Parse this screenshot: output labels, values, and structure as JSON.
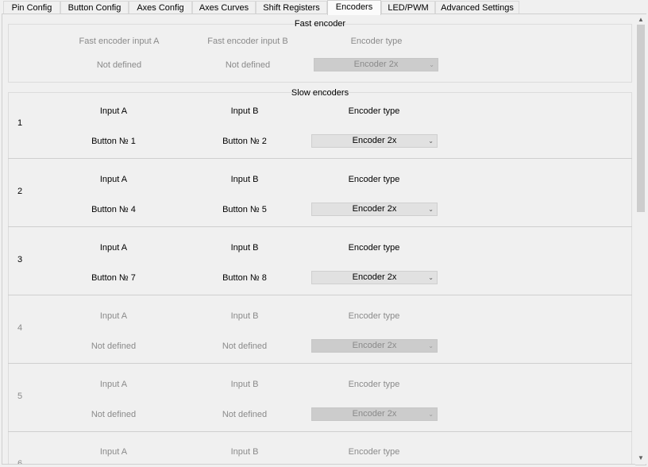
{
  "tabs": [
    {
      "label": "Pin Config",
      "active": false
    },
    {
      "label": "Button Config",
      "active": false
    },
    {
      "label": "Axes Config",
      "active": false
    },
    {
      "label": "Axes Curves",
      "active": false
    },
    {
      "label": "Shift Registers",
      "active": false
    },
    {
      "label": "Encoders",
      "active": true
    },
    {
      "label": "LED/PWM",
      "active": false
    },
    {
      "label": "Advanced Settings",
      "active": false
    }
  ],
  "fast": {
    "title": "Fast encoder",
    "header_a": "Fast encoder input A",
    "header_b": "Fast encoder input B",
    "header_type": "Encoder type",
    "value_a": "Not defined",
    "value_b": "Not defined",
    "type_value": "Encoder 2x"
  },
  "slow": {
    "title": "Slow encoders",
    "rows": [
      {
        "num": "1",
        "label_a": "Input A",
        "label_b": "Input B",
        "label_type": "Encoder type",
        "value_a": "Button № 1",
        "value_b": "Button № 2",
        "type_value": "Encoder 2x",
        "enabled": true
      },
      {
        "num": "2",
        "label_a": "Input A",
        "label_b": "Input B",
        "label_type": "Encoder type",
        "value_a": "Button № 4",
        "value_b": "Button № 5",
        "type_value": "Encoder 2x",
        "enabled": true
      },
      {
        "num": "3",
        "label_a": "Input A",
        "label_b": "Input B",
        "label_type": "Encoder type",
        "value_a": "Button № 7",
        "value_b": "Button № 8",
        "type_value": "Encoder 2x",
        "enabled": true
      },
      {
        "num": "4",
        "label_a": "Input A",
        "label_b": "Input B",
        "label_type": "Encoder type",
        "value_a": "Not defined",
        "value_b": "Not defined",
        "type_value": "Encoder 2x",
        "enabled": false
      },
      {
        "num": "5",
        "label_a": "Input A",
        "label_b": "Input B",
        "label_type": "Encoder type",
        "value_a": "Not defined",
        "value_b": "Not defined",
        "type_value": "Encoder 2x",
        "enabled": false
      },
      {
        "num": "6",
        "label_a": "Input A",
        "label_b": "Input B",
        "label_type": "Encoder type",
        "enabled": false
      }
    ]
  },
  "icons": {
    "dropdown": "chevron-down-icon",
    "scroll_up": "scroll-up-arrow-icon",
    "scroll_down": "scroll-down-arrow-icon"
  }
}
